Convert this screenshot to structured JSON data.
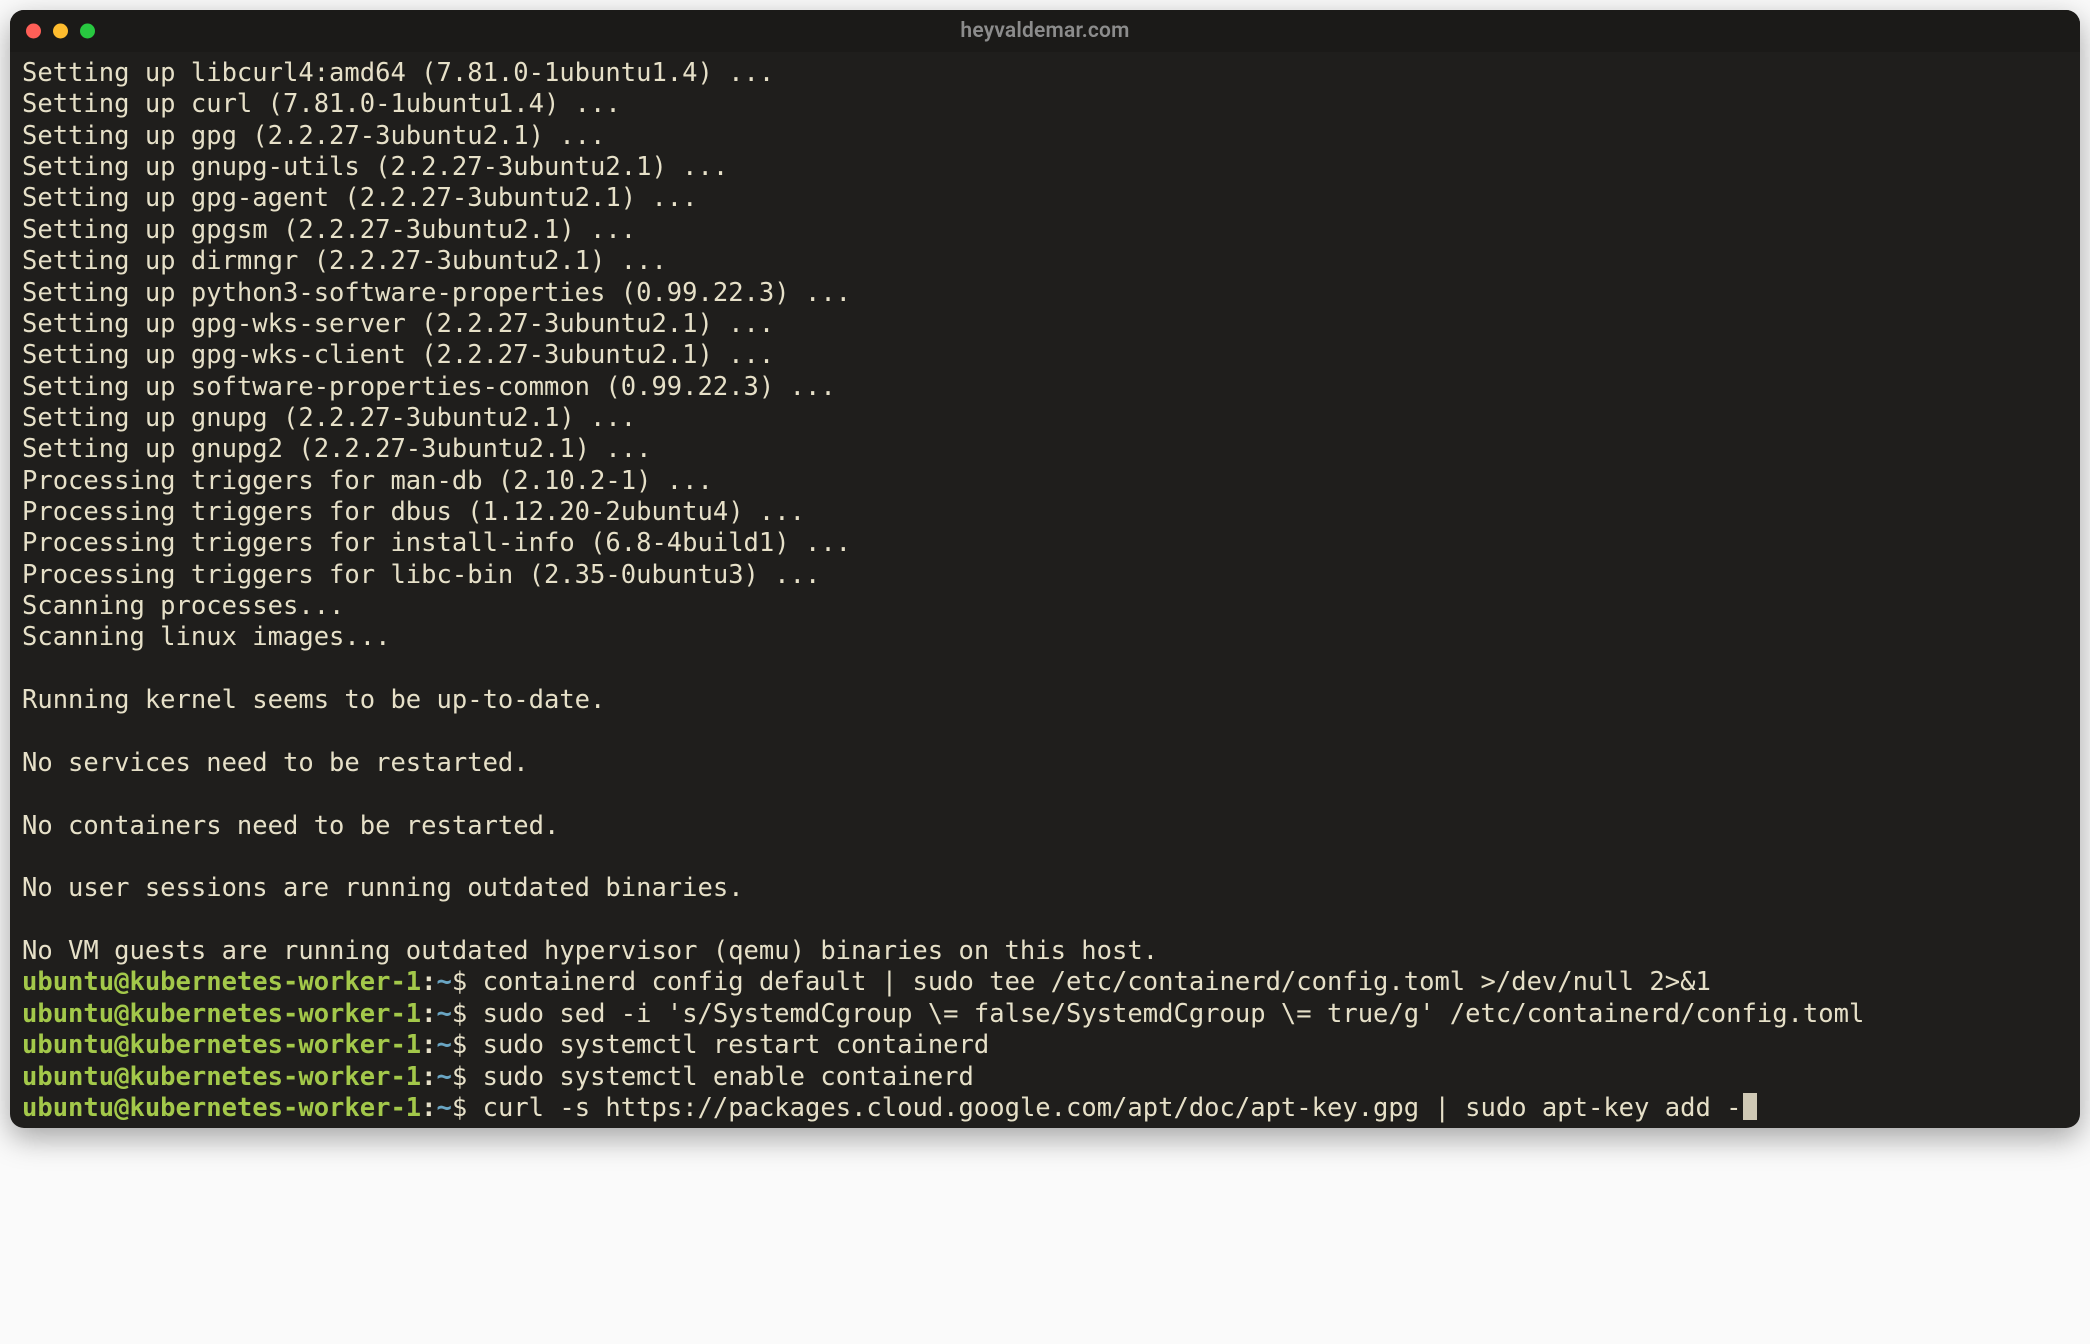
{
  "window": {
    "title": "heyvaldemar.com"
  },
  "colors": {
    "bg": "#1f1e1c",
    "fg": "#e6e0c8",
    "title": "#8c8c8c",
    "prompt_userhost": "#a3c84a",
    "prompt_path": "#6aa6c4",
    "traffic_red": "#ff5f57",
    "traffic_yellow": "#febc2e",
    "traffic_green": "#28c840"
  },
  "output_lines": [
    "Setting up libcurl4:amd64 (7.81.0-1ubuntu1.4) ...",
    "Setting up curl (7.81.0-1ubuntu1.4) ...",
    "Setting up gpg (2.2.27-3ubuntu2.1) ...",
    "Setting up gnupg-utils (2.2.27-3ubuntu2.1) ...",
    "Setting up gpg-agent (2.2.27-3ubuntu2.1) ...",
    "Setting up gpgsm (2.2.27-3ubuntu2.1) ...",
    "Setting up dirmngr (2.2.27-3ubuntu2.1) ...",
    "Setting up python3-software-properties (0.99.22.3) ...",
    "Setting up gpg-wks-server (2.2.27-3ubuntu2.1) ...",
    "Setting up gpg-wks-client (2.2.27-3ubuntu2.1) ...",
    "Setting up software-properties-common (0.99.22.3) ...",
    "Setting up gnupg (2.2.27-3ubuntu2.1) ...",
    "Setting up gnupg2 (2.2.27-3ubuntu2.1) ...",
    "Processing triggers for man-db (2.10.2-1) ...",
    "Processing triggers for dbus (1.12.20-2ubuntu4) ...",
    "Processing triggers for install-info (6.8-4build1) ...",
    "Processing triggers for libc-bin (2.35-0ubuntu3) ...",
    "Scanning processes...",
    "Scanning linux images...",
    "",
    "Running kernel seems to be up-to-date.",
    "",
    "No services need to be restarted.",
    "",
    "No containers need to be restarted.",
    "",
    "No user sessions are running outdated binaries.",
    "",
    "No VM guests are running outdated hypervisor (qemu) binaries on this host."
  ],
  "prompt": {
    "userhost": "ubuntu@kubernetes-worker-1",
    "colon": ":",
    "path": "~",
    "dollar": "$ "
  },
  "commands": [
    {
      "cmd": "containerd config default | sudo tee /etc/containerd/config.toml >/dev/null 2>&1",
      "cursor": false
    },
    {
      "cmd": "sudo sed -i 's/SystemdCgroup \\= false/SystemdCgroup \\= true/g' /etc/containerd/config.toml",
      "cursor": false
    },
    {
      "cmd": "sudo systemctl restart containerd",
      "cursor": false
    },
    {
      "cmd": "sudo systemctl enable containerd",
      "cursor": false
    },
    {
      "cmd": "curl -s https://packages.cloud.google.com/apt/doc/apt-key.gpg | sudo apt-key add -",
      "cursor": true
    }
  ]
}
